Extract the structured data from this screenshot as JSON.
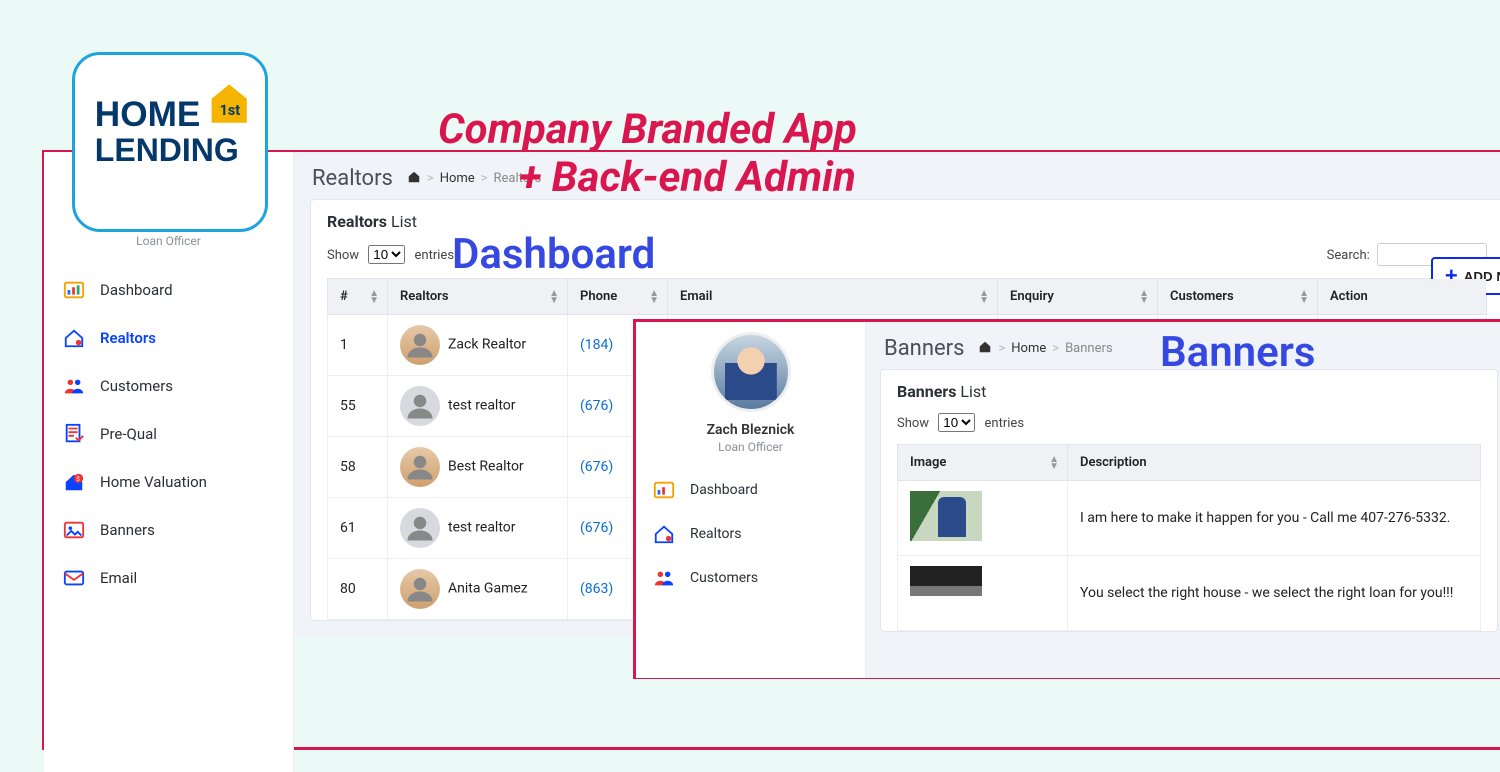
{
  "logo": {
    "line1": "HOME",
    "line2": "LENDING",
    "badge": "1st"
  },
  "headline": {
    "l1": "Company Branded App",
    "l2": "+ Back-end Admin"
  },
  "labels": {
    "dashboard": "Dashboard",
    "banners": "Banners"
  },
  "user": {
    "name": "Zach Bleznick",
    "role": "Loan Officer"
  },
  "sidebar_items": [
    {
      "key": "dashboard",
      "label": "Dashboard"
    },
    {
      "key": "realtors",
      "label": "Realtors"
    },
    {
      "key": "customers",
      "label": "Customers"
    },
    {
      "key": "prequal",
      "label": "Pre-Qual"
    },
    {
      "key": "home-valuation",
      "label": "Home Valuation"
    },
    {
      "key": "banners",
      "label": "Banners"
    },
    {
      "key": "email",
      "label": "Email"
    }
  ],
  "realtors": {
    "page_title": "Realtors",
    "breadcrumb": {
      "home": "Home",
      "current": "Realtors"
    },
    "card_title_bold": "Realtors",
    "card_title_rest": "List",
    "show_label": "Show",
    "entries_label": "entries",
    "show_value": "10",
    "search_label": "Search:",
    "add_button": "ADD N",
    "columns": [
      "#",
      "Realtors",
      "Phone",
      "Email",
      "Enquiry",
      "Customers",
      "Action"
    ],
    "rows": [
      {
        "num": "1",
        "name": "Zack Realtor",
        "phone": "(184)"
      },
      {
        "num": "55",
        "name": "test realtor",
        "phone": "(676)"
      },
      {
        "num": "58",
        "name": "Best Realtor",
        "phone": "(676)"
      },
      {
        "num": "61",
        "name": "test realtor",
        "phone": "(676)"
      },
      {
        "num": "80",
        "name": "Anita Gamez",
        "phone": "(863)"
      }
    ]
  },
  "banners": {
    "page_title": "Banners",
    "breadcrumb": {
      "home": "Home",
      "current": "Banners"
    },
    "card_title_bold": "Banners",
    "card_title_rest": "List",
    "show_label": "Show",
    "entries_label": "entries",
    "show_value": "10",
    "columns": [
      "Image",
      "Description"
    ],
    "rows": [
      {
        "desc": "I am here to make it happen for you - Call me 407-276-5332."
      },
      {
        "desc": "You select the right house - we select the right loan for you!!!"
      }
    ]
  }
}
